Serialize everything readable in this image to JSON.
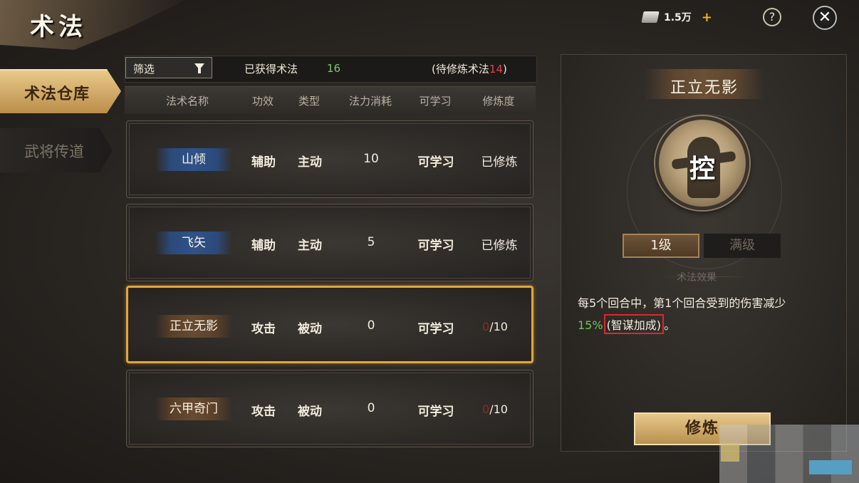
{
  "header": {
    "title": "术法",
    "currency_amount": "1.5万",
    "add_symbol": "+",
    "help_symbol": "?",
    "close_symbol": "✕"
  },
  "sidebar": {
    "items": [
      {
        "label": "术法仓库",
        "active": true
      },
      {
        "label": "武将传道",
        "active": false
      }
    ]
  },
  "list": {
    "filter_label": "筛选",
    "owned_label": "已获得术法",
    "owned_count": "16",
    "pending_prefix": "(待修炼术法",
    "pending_count": "14",
    "pending_suffix": ")",
    "columns": [
      "法术名称",
      "功效",
      "类型",
      "法力消耗",
      "可学习",
      "修炼度"
    ],
    "rows": [
      {
        "name": "山倾",
        "effect": "辅助",
        "type": "主动",
        "cost": "10",
        "learnable": "可学习",
        "progress": "已修炼",
        "badge": "blue"
      },
      {
        "name": "飞矢",
        "effect": "辅助",
        "type": "主动",
        "cost": "5",
        "learnable": "可学习",
        "progress": "已修炼",
        "badge": "blue"
      },
      {
        "name": "正立无影",
        "effect": "攻击",
        "type": "被动",
        "cost": "0",
        "learnable": "可学习",
        "progress_current": "0",
        "progress_total": "/10",
        "badge": "brown",
        "selected": true
      },
      {
        "name": "六甲奇门",
        "effect": "攻击",
        "type": "被动",
        "cost": "0",
        "learnable": "可学习",
        "progress_current": "0",
        "progress_total": "/10",
        "badge": "brown"
      }
    ]
  },
  "detail": {
    "title": "正立无影",
    "emblem_glyph": "控",
    "level_current": "1级",
    "level_max": "满级",
    "effect_label": "术法效果",
    "description_line1": "每5个回合中，第1个回合受到的伤害减少",
    "description_pct": "15%",
    "description_bonus": "(智谋加成)",
    "description_end": "。",
    "train_button": "修炼"
  },
  "colors": {
    "accent_gold": "#e1a63c",
    "positive_green": "#7cc86a",
    "warning_red": "#e2424a",
    "annotation_red": "#e0262b"
  }
}
